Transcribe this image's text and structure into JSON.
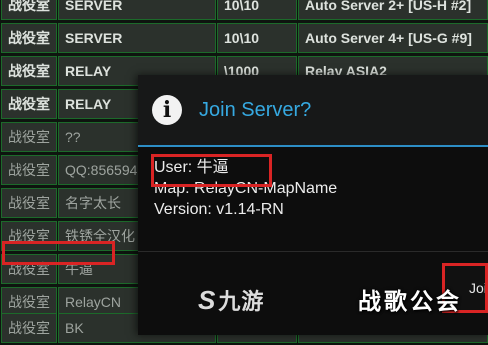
{
  "server_list": {
    "rows": [
      {
        "mode": "战役室",
        "type": "SERVER",
        "players": "10\\10",
        "name": "Auto Server 2+ [US-H #2]"
      },
      {
        "mode": "战役室",
        "type": "SERVER",
        "players": "10\\10",
        "name": "Auto Server 4+ [US-G #9]"
      },
      {
        "mode": "战役室",
        "type": "RELAY",
        "players": "\\1000",
        "name": "Relay ASIA2"
      },
      {
        "mode": "战役室",
        "type": "RELAY",
        "players": "",
        "name": ""
      },
      {
        "mode": "战役室",
        "type": "??",
        "players": "",
        "name": ""
      },
      {
        "mode": "战役室",
        "type": "QQ:856594",
        "players": "",
        "name": ""
      },
      {
        "mode": "战役室",
        "type": "名字太长",
        "players": "",
        "name": ""
      },
      {
        "mode": "战役室",
        "type": "铁锈全汉化",
        "players": "",
        "name": ""
      },
      {
        "mode": "战役室",
        "type": "牛逼",
        "players": "",
        "name": ""
      },
      {
        "mode": "战役室",
        "type": "RelayCN",
        "players": "",
        "name": ""
      },
      {
        "mode": "战役室",
        "type": "BK",
        "players": "",
        "name": ""
      }
    ]
  },
  "dialog": {
    "icon": "info-icon",
    "title": "Join Server?",
    "user_line": "User: 牛逼",
    "map_line": "Map: RelayCN-MapName",
    "version_line": "Version: v1.14-RN",
    "join_button_label": "Join"
  },
  "watermarks": {
    "left_logo": "九游",
    "right_logo": "战歌公会"
  },
  "colors": {
    "title_accent": "#36a9e1",
    "highlight_red": "#d92424",
    "cell_border_green": "#1c6a2a"
  }
}
